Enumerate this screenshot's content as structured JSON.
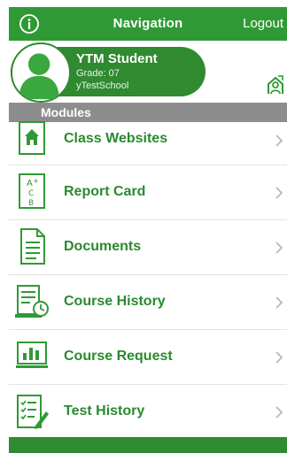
{
  "nav": {
    "title": "Navigation",
    "logout_label": "Logout",
    "info_icon": "info-circle-icon"
  },
  "profile": {
    "name": "YTM Student",
    "grade": "Grade: 07",
    "school": "yTestSchool",
    "switch_icon": "switch-student-icon"
  },
  "modules": {
    "header": "Modules",
    "items": [
      {
        "label": "Class Websites",
        "icon": "school-house-icon"
      },
      {
        "label": "Report Card",
        "icon": "report-card-icon"
      },
      {
        "label": "Documents",
        "icon": "document-icon"
      },
      {
        "label": "Course History",
        "icon": "course-history-icon"
      },
      {
        "label": "Course Request",
        "icon": "course-request-icon"
      },
      {
        "label": "Test History",
        "icon": "test-history-icon"
      }
    ]
  },
  "colors": {
    "brand_green": "#2f9a35",
    "label_green": "#2a8a2e",
    "header_gray": "#8d8d8d"
  }
}
